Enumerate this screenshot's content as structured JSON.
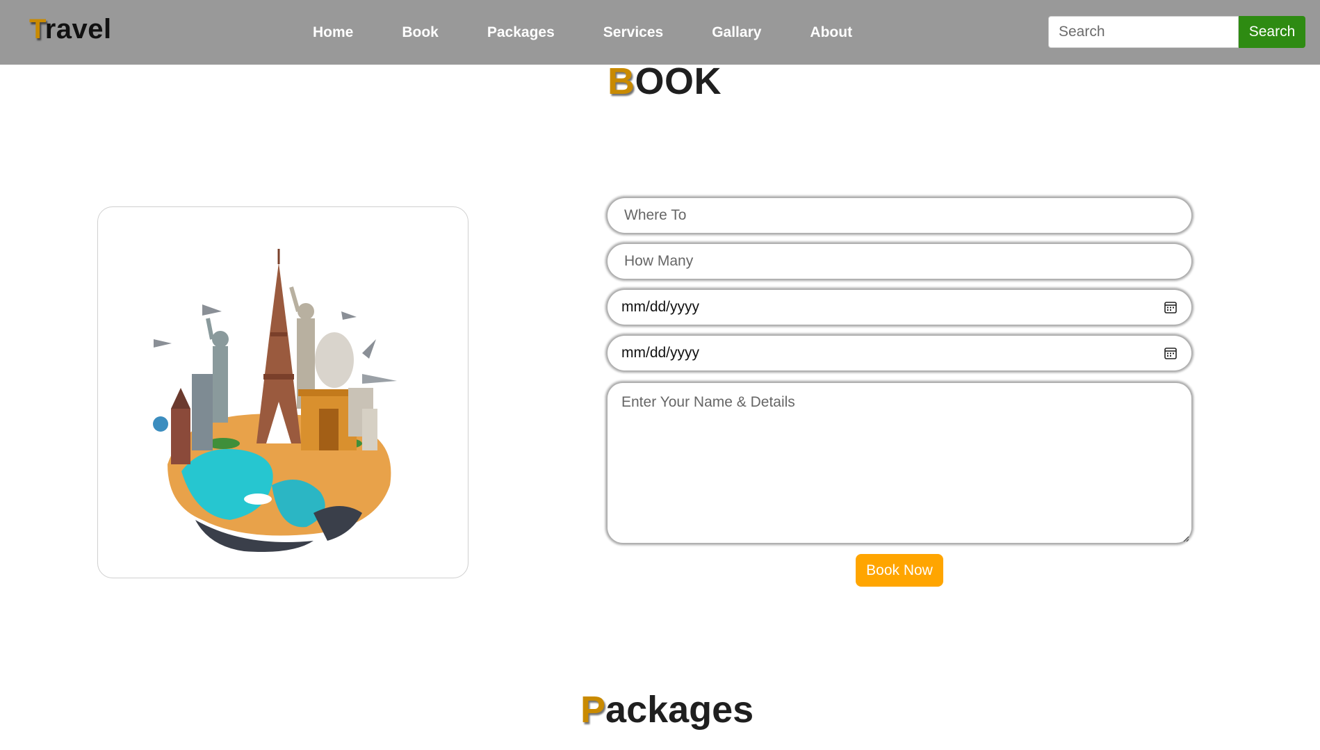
{
  "header": {
    "logo_first": "T",
    "logo_rest": "ravel",
    "nav": [
      "Home",
      "Book",
      "Packages",
      "Services",
      "Gallary",
      "About"
    ],
    "search_placeholder": "Search",
    "search_button": "Search"
  },
  "book": {
    "title_first": "B",
    "title_rest": "OOK",
    "where_placeholder": "Where To",
    "how_many_placeholder": "How Many",
    "arrival_date": "mm/dd/yyyy",
    "leaving_date": "mm/dd/yyyy",
    "details_placeholder": "Enter Your Name & Details",
    "submit": "Book Now"
  },
  "packages": {
    "title_first": "P",
    "title_rest": "ackages"
  },
  "colors": {
    "navbar": "#999999",
    "accent_letter": "#c98a00",
    "search_button": "#2e8b12",
    "book_button": "#ffa500"
  },
  "icons": {
    "date_picker": "calendar-icon",
    "illustration": "world-landmarks-illustration"
  }
}
